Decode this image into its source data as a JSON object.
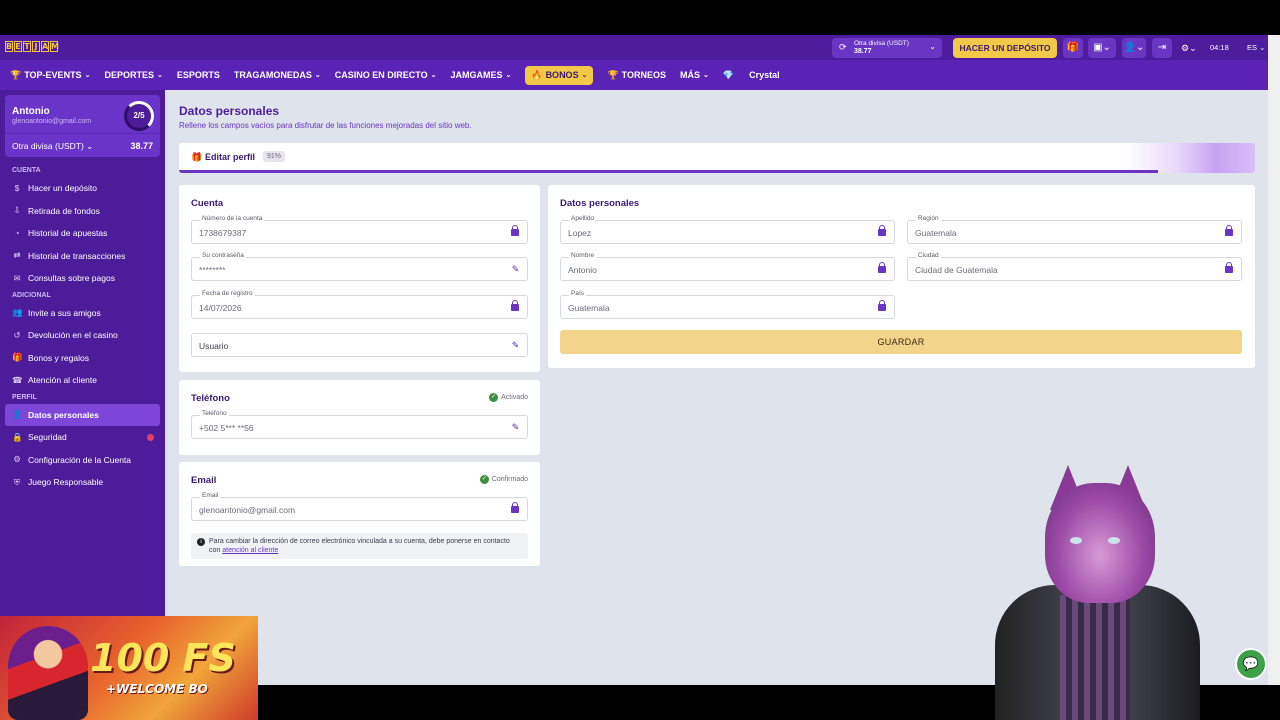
{
  "header": {
    "logo": [
      "B",
      "E",
      "T",
      "J",
      "A",
      "M"
    ],
    "currency_label": "Otra divisa (USDT)",
    "currency_amount": "38.77",
    "deposit_button": "HACER UN DEPÓSITO",
    "time": "04:18",
    "language": "ES"
  },
  "nav": {
    "items": [
      {
        "label": "TOP-EVENTS",
        "icon": "trophy-icon",
        "chevron": true
      },
      {
        "label": "DEPORTES",
        "chevron": true
      },
      {
        "label": "ESPORTS"
      },
      {
        "label": "TRAGAMONEDAS",
        "chevron": true
      },
      {
        "label": "CASINO EN DIRECTO",
        "chevron": true
      },
      {
        "label": "JAMGAMES",
        "chevron": true
      },
      {
        "label": "BONOS",
        "icon": "flame-icon",
        "chevron": true,
        "active": true
      },
      {
        "label": "TORNEOS",
        "icon": "trophy-icon"
      },
      {
        "label": "MÁS",
        "chevron": true
      },
      {
        "label": "Crystal",
        "icon": "diamond-icon"
      }
    ]
  },
  "sidebar": {
    "user_name": "Antonio",
    "user_email": "glenoantonio@gmail.com",
    "progress": "2/5",
    "balance_label": "Otra divisa (USDT)",
    "balance_value": "38.77",
    "sections": [
      {
        "title": "CUENTA",
        "items": [
          {
            "label": "Hacer un depósito",
            "icon": "dollar-icon"
          },
          {
            "label": "Retirada de fondos",
            "icon": "withdraw-icon"
          },
          {
            "label": "Historial de apuestas",
            "icon": "history-icon"
          },
          {
            "label": "Historial de transacciones",
            "icon": "transfer-icon"
          },
          {
            "label": "Consultas sobre pagos",
            "icon": "chat-icon"
          }
        ]
      },
      {
        "title": "ADICIONAL",
        "items": [
          {
            "label": "Invite a sus amigos",
            "icon": "users-icon"
          },
          {
            "label": "Devolución en el casino",
            "icon": "cashback-icon"
          },
          {
            "label": "Bonos y regalos",
            "icon": "gift-icon"
          },
          {
            "label": "Atención al cliente",
            "icon": "support-icon"
          }
        ]
      },
      {
        "title": "PERFIL",
        "items": [
          {
            "label": "Datos personales",
            "icon": "user-icon",
            "active": true
          },
          {
            "label": "Seguridad",
            "icon": "lock-icon",
            "alert": true
          },
          {
            "label": "Configuración de la Cuenta",
            "icon": "gear-icon"
          },
          {
            "label": "Juego Responsable",
            "icon": "shield-icon"
          }
        ]
      }
    ]
  },
  "page": {
    "title": "Datos personales",
    "subtitle": "Rellene los campos vacíos para disfrutar de las funciones mejoradas del sitio web.",
    "tab_label": "Editar perfil",
    "tab_percent": "91%",
    "completion": 0.91
  },
  "cuenta": {
    "title": "Cuenta",
    "account_number_label": "Número de la cuenta",
    "account_number": "1738679387",
    "password_label": "Su contraseña",
    "password": "********",
    "reg_date_label": "Fecha de registro",
    "reg_date": "14/07/2026",
    "username_placeholder": "Usuario"
  },
  "telefono": {
    "title": "Teléfono",
    "status": "Activado",
    "phone_label": "Teléfono",
    "phone": "+502 5*** **56"
  },
  "email": {
    "title": "Email",
    "status": "Confirmado",
    "email_label": "Email",
    "email": "glenoantonio@gmail.com",
    "note": "Para cambiar la dirección de correo electrónico vinculada a su cuenta, debe ponerse en contacto con ",
    "note_link": "atención al cliente"
  },
  "personal": {
    "title": "Datos personales",
    "apellido_label": "Apellido",
    "apellido": "Lopez",
    "nombre_label": "Nombre",
    "nombre": "Antonio",
    "pais_label": "País",
    "pais": "Guatemala",
    "region_label": "Región",
    "region": "Guatemala",
    "ciudad_label": "Ciudad",
    "ciudad": "Ciudad de Guatemala",
    "save_button": "GUARDAR"
  },
  "promo": {
    "big": "100 FS",
    "small": "+WELCOME BO"
  },
  "colors": {
    "brand": "#4e1d9e",
    "accent": "#f2c849",
    "success": "#3e8e3e"
  }
}
